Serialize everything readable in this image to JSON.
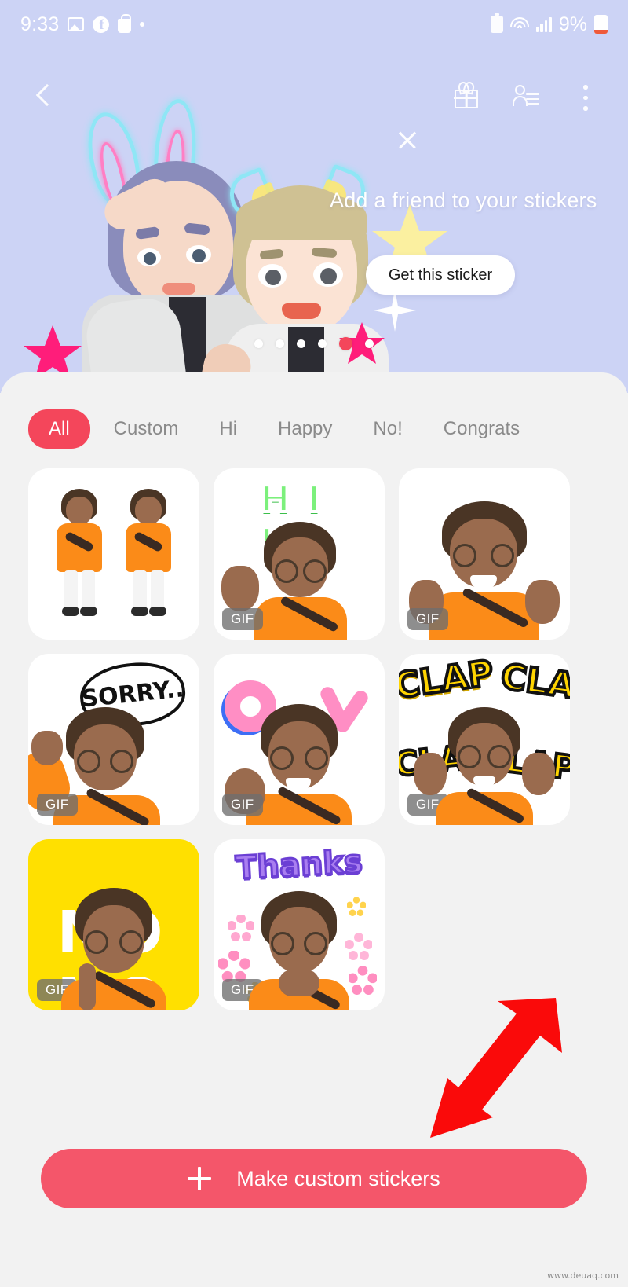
{
  "status_bar": {
    "clock": "9:33",
    "battery_percent": "9%",
    "left_icons": [
      "photos-icon",
      "facebook-icon",
      "shopping-bag-icon",
      "dot-indicator-icon"
    ],
    "right_icons": [
      "battery-saver-icon",
      "wifi-icon",
      "signal-icon",
      "battery-icon"
    ]
  },
  "hero": {
    "title": "Add a friend to your stickers",
    "cta_label": "Get this sticker",
    "back_icon": "chevron-left-icon",
    "gift_icon": "gift-icon",
    "contacts_icon": "contacts-icon",
    "menu_icon": "kebab-menu-icon",
    "close_icon": "close-icon",
    "background_color": "#ccd3f5",
    "pagination": {
      "count": 6,
      "active_index": 4
    }
  },
  "tabs": [
    {
      "label": "All",
      "active": true
    },
    {
      "label": "Custom",
      "active": false
    },
    {
      "label": "Hi",
      "active": false
    },
    {
      "label": "Happy",
      "active": false
    },
    {
      "label": "No!",
      "active": false
    },
    {
      "label": "Congrats",
      "active": false
    }
  ],
  "stickers": [
    {
      "name": "full-body-pair",
      "gif": false,
      "badge": "",
      "word": "",
      "bg": "white"
    },
    {
      "name": "hi-wave",
      "gif": true,
      "badge": "GIF",
      "word": "HI  HI",
      "bg": "white"
    },
    {
      "name": "thumbs-up",
      "gif": true,
      "badge": "GIF",
      "word": "",
      "bg": "white"
    },
    {
      "name": "sorry",
      "gif": true,
      "badge": "GIF",
      "word": "SORRY..",
      "bg": "white"
    },
    {
      "name": "ok-sign",
      "gif": true,
      "badge": "GIF",
      "word": "O K",
      "bg": "white"
    },
    {
      "name": "clap",
      "gif": true,
      "badge": "GIF",
      "word": "CLAP",
      "bg": "white"
    },
    {
      "name": "no-no",
      "gif": true,
      "badge": "GIF",
      "word": "NO NO",
      "bg": "yellow"
    },
    {
      "name": "thanks",
      "gif": true,
      "badge": "GIF",
      "word": "Thanks",
      "bg": "white"
    }
  ],
  "bottom": {
    "make_label": "Make custom stickers",
    "plus_icon": "plus-icon"
  },
  "annotation": {
    "arrow_icon": "red-arrow-pointer",
    "arrow_color": "#fa0a0a"
  },
  "watermark": "www.deuaq.com",
  "colors": {
    "accent": "#f4465b",
    "button": "#f4566a",
    "hero_bg": "#ccd3f5",
    "sheet_bg": "#f2f2f2",
    "shirt": "#fb8b18",
    "yellow_tile": "#ffe000"
  }
}
